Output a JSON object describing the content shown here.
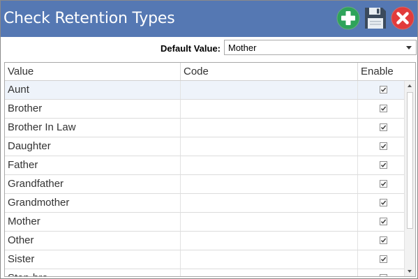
{
  "window": {
    "title": "Check Retention Types",
    "accent_color": "#5578b3"
  },
  "toolbar": {
    "add_icon": "plus-circle-icon",
    "save_icon": "floppy-disk-icon",
    "close_icon": "x-circle-icon"
  },
  "default_value": {
    "label": "Default Value:",
    "selected": "Mother"
  },
  "grid": {
    "columns": [
      "Value",
      "Code",
      "Enable"
    ],
    "rows": [
      {
        "value": "Aunt",
        "code": "",
        "enabled": true
      },
      {
        "value": "Brother",
        "code": "",
        "enabled": true
      },
      {
        "value": "Brother In Law",
        "code": "",
        "enabled": true
      },
      {
        "value": "Daughter",
        "code": "",
        "enabled": true
      },
      {
        "value": "Father",
        "code": "",
        "enabled": true
      },
      {
        "value": "Grandfather",
        "code": "",
        "enabled": true
      },
      {
        "value": "Grandmother",
        "code": "",
        "enabled": true
      },
      {
        "value": "Mother",
        "code": "",
        "enabled": true
      },
      {
        "value": "Other",
        "code": "",
        "enabled": true
      },
      {
        "value": "Sister",
        "code": "",
        "enabled": true
      },
      {
        "value": "Step-bro...",
        "code": "",
        "enabled": true
      }
    ],
    "selected_row": 0
  }
}
